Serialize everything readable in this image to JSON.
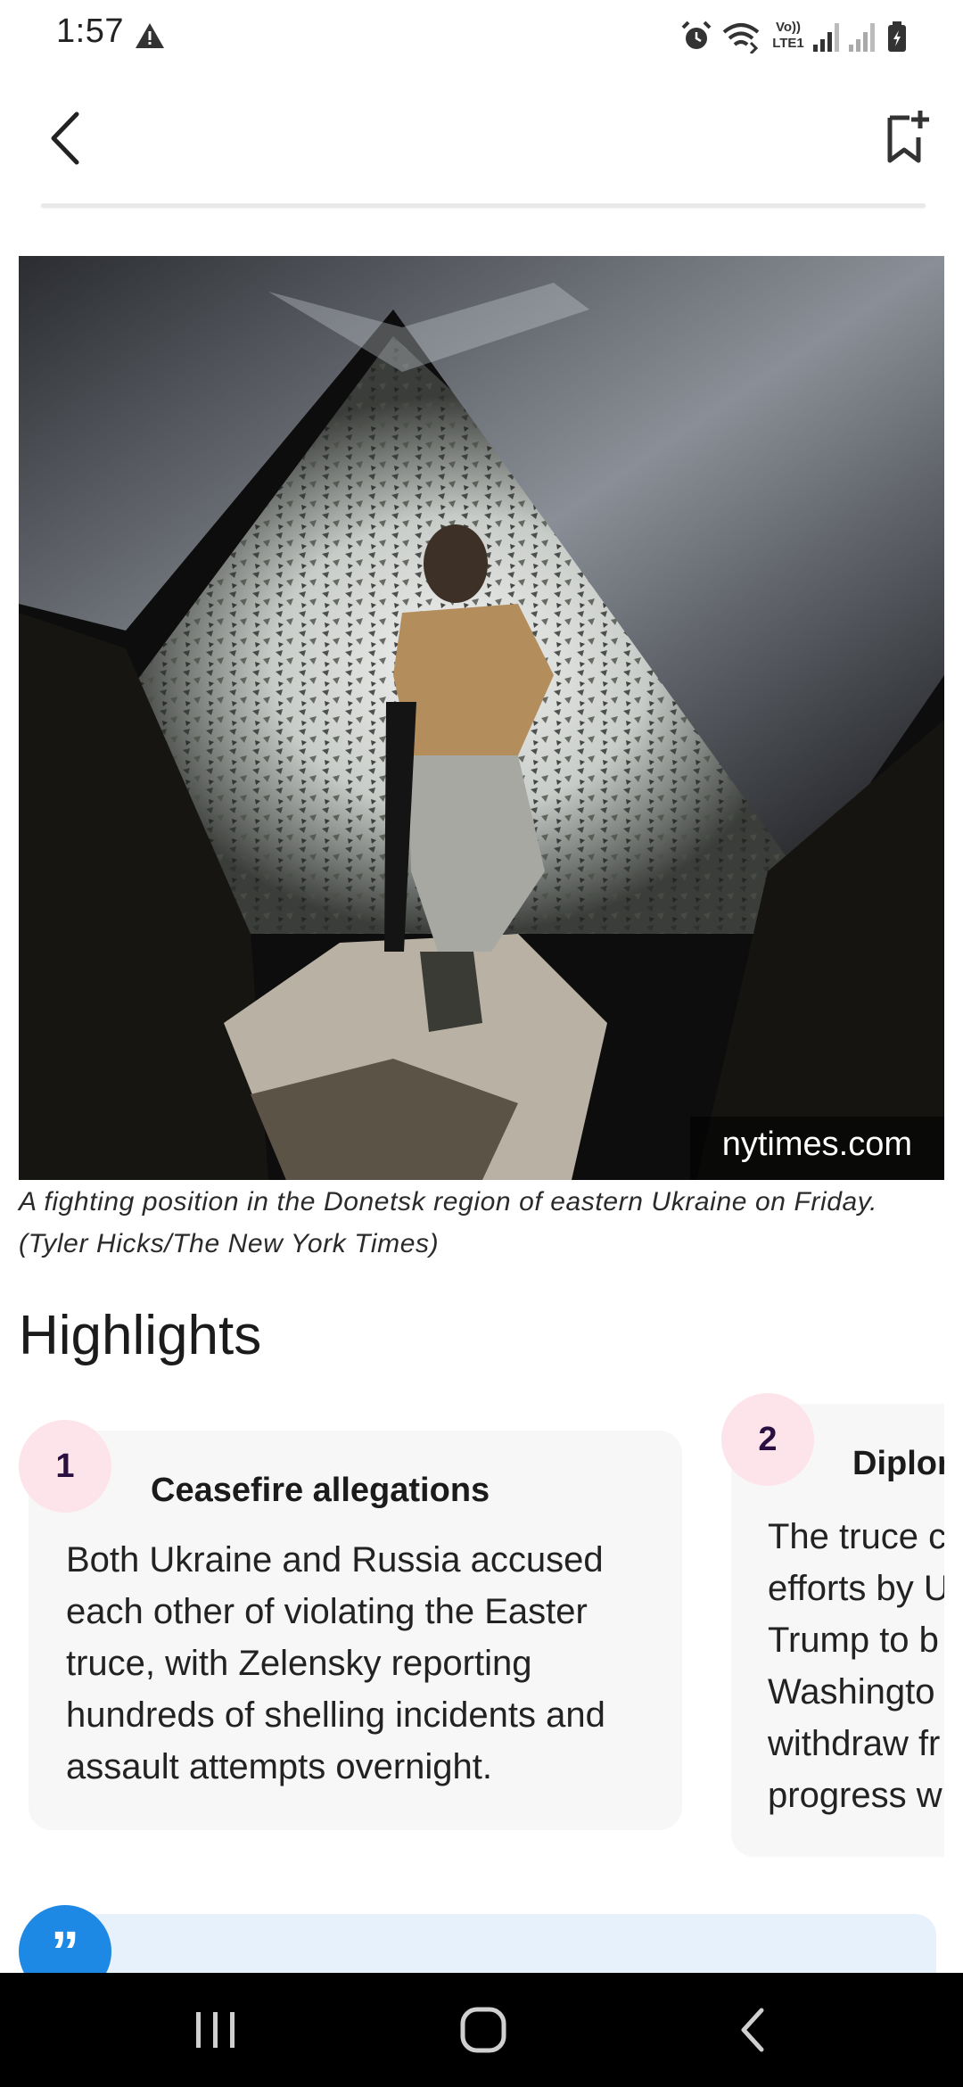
{
  "status_bar": {
    "time": "1:57",
    "icons": [
      "warning-icon",
      "alarm-icon",
      "wifi-icon",
      "volte-icon",
      "signal-icon",
      "signal-icon",
      "battery-icon"
    ],
    "volte_top": "Vo))",
    "volte_bottom": "LTE1"
  },
  "top_bar": {
    "back_icon": "chevron-left-icon",
    "bookmark_icon": "bookmark-add-icon"
  },
  "hero": {
    "source": "nytimes.com",
    "caption": "A fighting position in the Donetsk region of eastern Ukraine on Friday. (Tyler Hicks/The New York Times)"
  },
  "highlights": {
    "title": "Highlights",
    "items": [
      {
        "number": "1",
        "title": "Ceasefire allegations",
        "lines": [
          "Both Ukraine and Russia accused",
          "each other of violating the Easter",
          "truce, with Zelensky reporting",
          "hundreds of shelling incidents and",
          "assault attempts overnight."
        ]
      },
      {
        "number": "2",
        "title": "Diplor",
        "lines": [
          "The truce c",
          "efforts by U",
          "Trump to b",
          "Washingto",
          "withdraw fr",
          "progress w"
        ]
      }
    ]
  },
  "quote": {
    "icon": "quote-icon",
    "glyph": "”"
  },
  "nav_bar": {
    "icons": [
      "recent-apps-icon",
      "home-icon",
      "back-icon"
    ]
  }
}
